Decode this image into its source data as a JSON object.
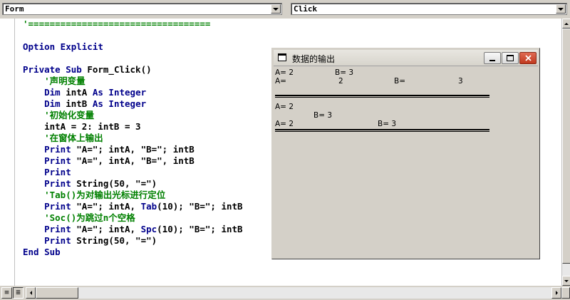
{
  "toolbar": {
    "object_combo": "Form",
    "procedure_combo": "Click"
  },
  "code": [
    [
      {
        "c": "cm",
        "t": "'=================================="
      }
    ],
    [
      {
        "c": "tx",
        "t": ""
      }
    ],
    [
      {
        "c": "kw",
        "t": "Option Explicit"
      }
    ],
    [
      {
        "c": "tx",
        "t": ""
      }
    ],
    [
      {
        "c": "kw",
        "t": "Private Sub "
      },
      {
        "c": "tx",
        "t": "Form_Click()"
      }
    ],
    [
      {
        "c": "cm",
        "t": "    '声明变量"
      }
    ],
    [
      {
        "c": "kw",
        "t": "    Dim "
      },
      {
        "c": "tx",
        "t": "intA "
      },
      {
        "c": "kw",
        "t": "As Integer"
      }
    ],
    [
      {
        "c": "kw",
        "t": "    Dim "
      },
      {
        "c": "tx",
        "t": "intB "
      },
      {
        "c": "kw",
        "t": "As Integer"
      }
    ],
    [
      {
        "c": "cm",
        "t": "    '初始化变量"
      }
    ],
    [
      {
        "c": "tx",
        "t": "    intA = 2: intB = 3"
      }
    ],
    [
      {
        "c": "cm",
        "t": "    '在窗体上输出"
      }
    ],
    [
      {
        "c": "kw",
        "t": "    Print "
      },
      {
        "c": "tx",
        "t": "\"A=\"; intA, \"B=\"; intB"
      }
    ],
    [
      {
        "c": "kw",
        "t": "    Print "
      },
      {
        "c": "tx",
        "t": "\"A=\", intA, \"B=\", intB"
      }
    ],
    [
      {
        "c": "kw",
        "t": "    Print"
      }
    ],
    [
      {
        "c": "kw",
        "t": "    Print "
      },
      {
        "c": "tx",
        "t": "String(50, \"=\")"
      }
    ],
    [
      {
        "c": "cm",
        "t": "    'Tab()为对输出光标进行定位"
      }
    ],
    [
      {
        "c": "kw",
        "t": "    Print "
      },
      {
        "c": "tx",
        "t": "\"A=\"; intA, "
      },
      {
        "c": "kw",
        "t": "Tab"
      },
      {
        "c": "tx",
        "t": "(10); \"B=\"; intB"
      }
    ],
    [
      {
        "c": "cm",
        "t": "    'Soc()为跳过n个空格"
      }
    ],
    [
      {
        "c": "kw",
        "t": "    Print "
      },
      {
        "c": "tx",
        "t": "\"A=\"; intA, "
      },
      {
        "c": "kw",
        "t": "Spc"
      },
      {
        "c": "tx",
        "t": "(10); \"B=\"; intB"
      }
    ],
    [
      {
        "c": "kw",
        "t": "    Print "
      },
      {
        "c": "tx",
        "t": "String(50, \"=\")"
      }
    ],
    [
      {
        "c": "kw",
        "t": "End Sub"
      }
    ]
  ],
  "form_window": {
    "title": "数据的输出",
    "output": {
      "l1_a": "A= 2",
      "l1_b": "B= 3",
      "l2_a": "A=",
      "l2_av": "2",
      "l2_b": "B=",
      "l2_bv": "3",
      "l3_a": "A= 2",
      "l4_b": "B= 3",
      "l5_a": "A= 2",
      "l5_b": "B= 3"
    }
  }
}
